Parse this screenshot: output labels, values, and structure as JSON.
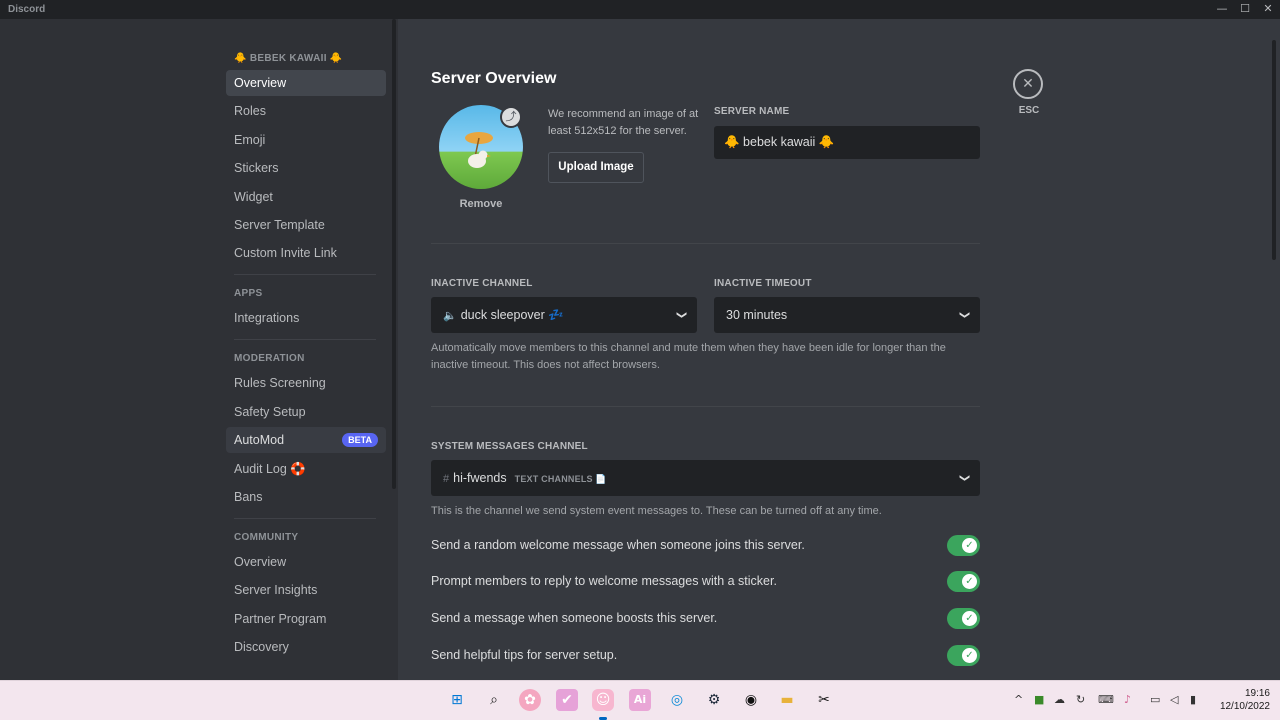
{
  "window": {
    "title": "Discord",
    "controls": [
      "—",
      "☐",
      "✕"
    ]
  },
  "sidebar": {
    "server_header": "🐥 BEBEK KAWAII 🐥",
    "server_items": [
      "Overview",
      "Roles",
      "Emoji",
      "Stickers",
      "Widget",
      "Server Template",
      "Custom Invite Link"
    ],
    "apps_header": "APPS",
    "apps_items": [
      "Integrations"
    ],
    "moderation_header": "MODERATION",
    "moderation_items": [
      "Rules Screening",
      "Safety Setup",
      "AutoMod",
      "Audit Log 🛟",
      "Bans"
    ],
    "automod_badge": "BETA",
    "community_header": "COMMUNITY",
    "community_items": [
      "Overview",
      "Server Insights",
      "Partner Program",
      "Discovery"
    ]
  },
  "main": {
    "title": "Server Overview",
    "icon_remove": "Remove",
    "recommend_text": "We recommend an image of at least 512x512 for the server.",
    "upload_button": "Upload Image",
    "server_name_label": "SERVER NAME",
    "server_name_value": "🐥 bebek kawaii 🐥",
    "inactive_channel_label": "INACTIVE CHANNEL",
    "inactive_channel_value": "duck sleepover 💤",
    "inactive_timeout_label": "INACTIVE TIMEOUT",
    "inactive_timeout_value": "30 minutes",
    "inactive_help": "Automatically move members to this channel and mute them when they have been idle for longer than the inactive timeout. This does not affect browsers.",
    "system_channel_label": "SYSTEM MESSAGES CHANNEL",
    "system_channel_value": "hi-fwends",
    "system_channel_category": "TEXT CHANNELS 📄",
    "system_help": "This is the channel we send system event messages to. These can be turned off at any time.",
    "toggles": [
      {
        "label": "Send a random welcome message when someone joins this server.",
        "on": true
      },
      {
        "label": "Prompt members to reply to welcome messages with a sticker.",
        "on": true
      },
      {
        "label": "Send a message when someone boosts this server.",
        "on": true
      },
      {
        "label": "Send helpful tips for server setup.",
        "on": true
      }
    ],
    "esc_label": "ESC"
  },
  "taskbar": {
    "time": "19:16",
    "date": "12/10/2022",
    "apps": [
      "windows-start",
      "search",
      "app-pink",
      "app-pink-2",
      "discord",
      "ai-app",
      "edge",
      "steam",
      "obs",
      "file-explorer",
      "capcut"
    ]
  },
  "colors": {
    "accent": "#5865f2",
    "toggle_on": "#3ba55d",
    "background": "#36393f",
    "sidebar": "#2f3136"
  }
}
